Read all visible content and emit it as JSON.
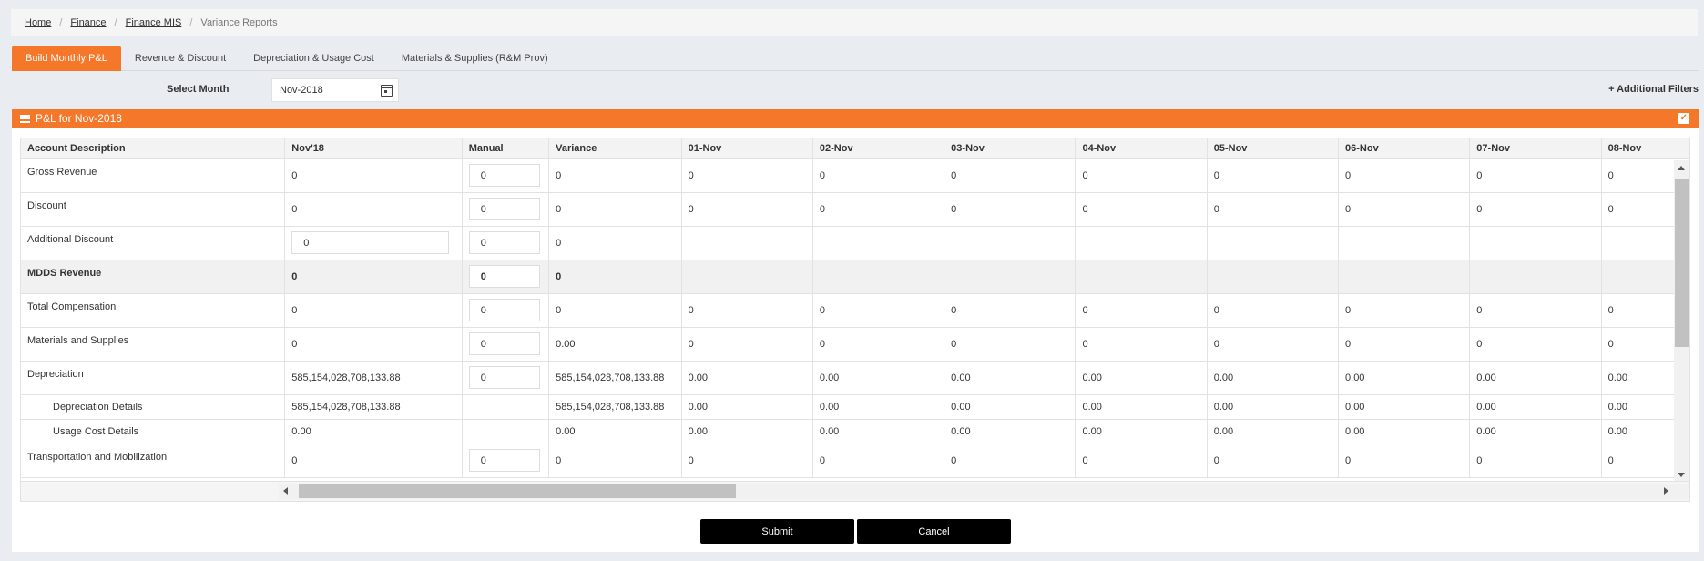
{
  "breadcrumb": {
    "home": "Home",
    "finance": "Finance",
    "finance_mis": "Finance MIS",
    "current": "Variance Reports"
  },
  "tabs": [
    {
      "label": "Build Monthly P&L",
      "active": true
    },
    {
      "label": "Revenue & Discount",
      "active": false
    },
    {
      "label": "Depreciation & Usage Cost",
      "active": false
    },
    {
      "label": "Materials & Supplies (R&M Prov)",
      "active": false
    }
  ],
  "filters": {
    "select_month_label": "Select Month",
    "month_value": "Nov-2018",
    "additional_filters": "+ Additional Filters"
  },
  "panel": {
    "title": "P&L for Nov-2018"
  },
  "table": {
    "headers": [
      "Account Description",
      "Nov'18",
      "Manual",
      "Variance",
      "01-Nov",
      "02-Nov",
      "03-Nov",
      "04-Nov",
      "05-Nov",
      "06-Nov",
      "07-Nov",
      "08-Nov"
    ],
    "rows": [
      {
        "desc": "Gross Revenue",
        "nov": "0",
        "manual": "0",
        "variance": "0",
        "days": [
          "0",
          "0",
          "0",
          "0",
          "0",
          "0",
          "0",
          "0"
        ]
      },
      {
        "desc": "Discount",
        "nov": "0",
        "manual": "0",
        "variance": "0",
        "days": [
          "0",
          "0",
          "0",
          "0",
          "0",
          "0",
          "0",
          "0"
        ]
      },
      {
        "desc": "Additional Discount",
        "nov": "0",
        "manual": "0",
        "variance": "0",
        "days": [
          "",
          "",
          "",
          "",
          "",
          "",
          "",
          ""
        ]
      },
      {
        "desc": "MDDS Revenue",
        "nov": "0",
        "manual": "0",
        "variance": "0",
        "days": [
          "",
          "",
          "",
          "",
          "",
          "",
          "",
          ""
        ]
      },
      {
        "desc": "Total Compensation",
        "nov": "0",
        "manual": "0",
        "variance": "0",
        "days": [
          "0",
          "0",
          "0",
          "0",
          "0",
          "0",
          "0",
          "0"
        ]
      },
      {
        "desc": "Materials and Supplies",
        "nov": "0",
        "manual": "0",
        "variance": "0.00",
        "days": [
          "0",
          "0",
          "0",
          "0",
          "0",
          "0",
          "0",
          "0"
        ]
      },
      {
        "desc": "Depreciation",
        "nov": "585,154,028,708,133.88",
        "manual": "0",
        "variance": "585,154,028,708,133.88",
        "days": [
          "0.00",
          "0.00",
          "0.00",
          "0.00",
          "0.00",
          "0.00",
          "0.00",
          "0.00"
        ]
      },
      {
        "desc": "Depreciation Details",
        "nov": "585,154,028,708,133.88",
        "manual": "",
        "variance": "585,154,028,708,133.88",
        "days": [
          "0.00",
          "0.00",
          "0.00",
          "0.00",
          "0.00",
          "0.00",
          "0.00",
          "0.00"
        ]
      },
      {
        "desc": "Usage Cost Details",
        "nov": "0.00",
        "manual": "",
        "variance": "0.00",
        "days": [
          "0.00",
          "0.00",
          "0.00",
          "0.00",
          "0.00",
          "0.00",
          "0.00",
          "0.00"
        ]
      },
      {
        "desc": "Transportation and Mobilization",
        "nov": "0",
        "manual": "0",
        "variance": "0",
        "days": [
          "0",
          "0",
          "0",
          "0",
          "0",
          "0",
          "0",
          "0"
        ]
      }
    ]
  },
  "buttons": {
    "submit": "Submit",
    "cancel": "Cancel"
  },
  "icons": {
    "calendar": "calendar-icon",
    "panel": "list-icon",
    "checkbox": "checkbox-checked-icon"
  },
  "colors": {
    "accent": "#f4772a",
    "button": "#000000"
  }
}
